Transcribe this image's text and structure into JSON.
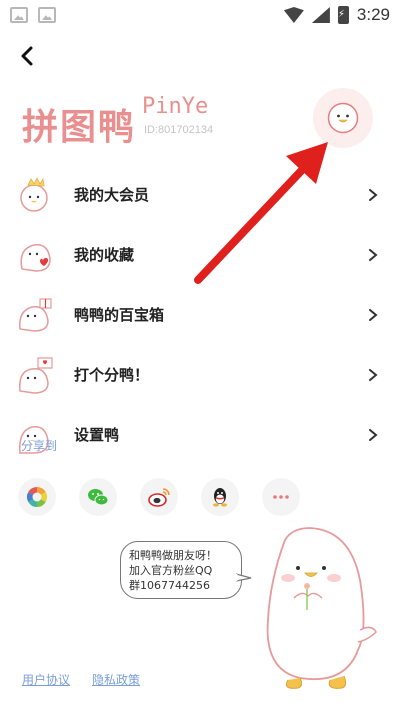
{
  "status_bar": {
    "time": "3:29",
    "icons": [
      "gallery-icon",
      "image-icon",
      "wifi-icon",
      "signal-icon",
      "battery-charging-icon"
    ]
  },
  "header": {
    "logo_text": "拼图鸭",
    "logo_latin": "PinYe",
    "user_id": "ID:801702134"
  },
  "menu": {
    "items": [
      {
        "label": "我的大会员",
        "icon": "crown-duck-icon"
      },
      {
        "label": "我的收藏",
        "icon": "heart-duck-icon"
      },
      {
        "label": "鸭鸭的百宝箱",
        "icon": "gift-duck-icon"
      },
      {
        "label": "打个分鸭！",
        "icon": "rating-duck-icon"
      },
      {
        "label": "设置鸭",
        "icon": "settings-duck-icon"
      }
    ]
  },
  "share": {
    "label": "分享到",
    "targets": [
      "moments-icon",
      "wechat-icon",
      "weibo-icon",
      "qq-icon",
      "more-icon"
    ]
  },
  "bubble": {
    "lines": [
      "和鸭鸭做朋友呀！",
      "加入官方粉丝QQ",
      "群1067744256"
    ]
  },
  "footer": {
    "user_agreement": "用户协议",
    "privacy_policy": "隐私政策"
  },
  "colors": {
    "brand_pink": "#ea8f8f",
    "link_blue": "#7a9ed8",
    "annotation_red": "#e0201c"
  }
}
